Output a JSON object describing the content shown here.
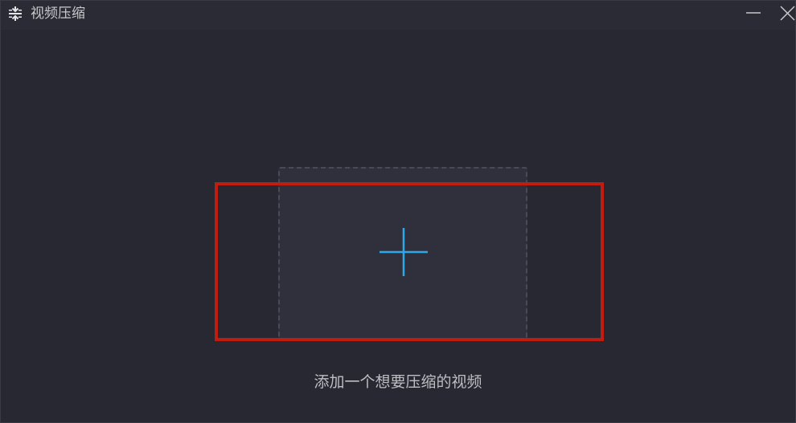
{
  "window": {
    "title": "视频压缩",
    "icon": "compress-icon",
    "controls": {
      "minimize": "minimize-icon",
      "close": "close-icon"
    }
  },
  "main": {
    "add_icon": "plus-icon",
    "hint": "添加一个想要压缩的视频"
  },
  "colors": {
    "background": "#282832",
    "drop_area": "#30303c",
    "accent": "#2fa8e8",
    "highlight": "#c01d10",
    "text": "#bdbdc2"
  }
}
